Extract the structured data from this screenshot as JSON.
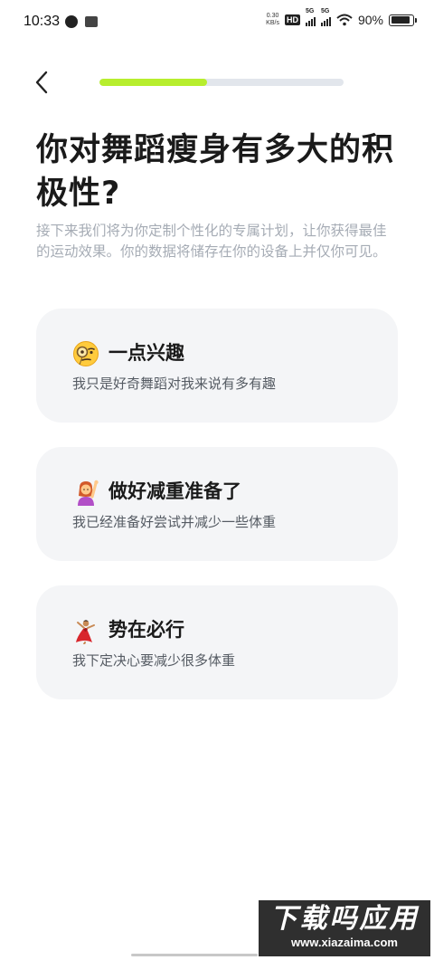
{
  "status_bar": {
    "time": "10:33",
    "speed_value": "0.30",
    "speed_unit": "KB/s",
    "hd_label": "HD",
    "sim1_label": "5G",
    "sim2_label": "5G",
    "battery_percent": "90%",
    "battery_level": 0.9
  },
  "header": {
    "progress": 0.44,
    "progress_color": "#b7ee2e",
    "track_color": "#e2e6ec"
  },
  "title": "你对舞蹈瘦身有多大的积极性?",
  "subtitle": "接下来我们将为你定制个性化的专属计划，让你获得最佳的运动效果。你的数据将储存在你的设备上并仅你可见。",
  "options": [
    {
      "icon": "face-with-monocle-emoji",
      "title": "一点兴趣",
      "description": "我只是好奇舞蹈对我来说有多有趣"
    },
    {
      "icon": "person-raising-hand-emoji",
      "title": "做好减重准备了",
      "description": "我已经准备好尝试并减少一些体重"
    },
    {
      "icon": "dancer-emoji",
      "title": "势在必行",
      "description": "我下定决心要减少很多体重"
    }
  ],
  "watermark": {
    "main": "下载吗应用",
    "url": "www.xiazaima.com"
  }
}
